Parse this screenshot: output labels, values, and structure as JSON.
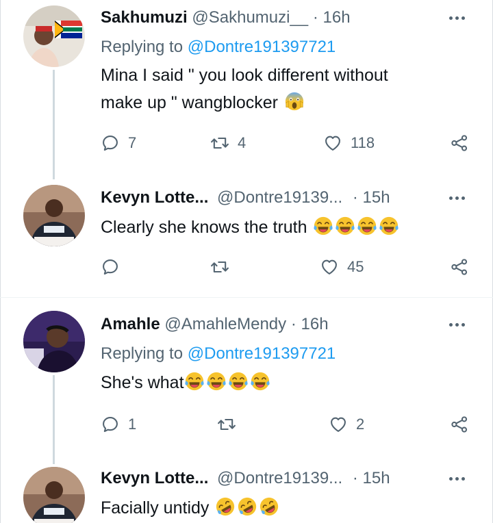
{
  "tweets": [
    {
      "name": "Sakhumuzi",
      "handle": "@Sakhumuzi__",
      "time": "16h",
      "replying_label": "Replying to",
      "replying_to": "@Dontre191397721",
      "text_line1": "Mina I said \" you look different without",
      "text_line2": "make up \" wangblocker",
      "emoji": [
        "face-screaming-in-fear"
      ],
      "counts": {
        "replies": "7",
        "retweets": "4",
        "likes": "118"
      }
    },
    {
      "name": "Kevyn Lotte...",
      "handle": "@Dontre19139...",
      "time": "15h",
      "text": "Clearly she knows the truth",
      "emoji": [
        "tears-of-joy",
        "tears-of-joy",
        "tears-of-joy",
        "tears-of-joy"
      ],
      "counts": {
        "replies": "",
        "retweets": "",
        "likes": "45"
      }
    },
    {
      "name": "Amahle",
      "handle": "@AmahleMendy",
      "time": "16h",
      "replying_label": "Replying to",
      "replying_to": "@Dontre191397721",
      "text": "She's what",
      "emoji": [
        "tears-of-joy",
        "tears-of-joy",
        "tears-of-joy",
        "tears-of-joy"
      ],
      "counts": {
        "replies": "1",
        "retweets": "",
        "likes": "2"
      }
    },
    {
      "name": "Kevyn Lotte...",
      "handle": "@Dontre19139...",
      "time": "15h",
      "text": "Facially untidy",
      "emoji": [
        "rolling-on-floor-laughing",
        "rolling-on-floor-laughing",
        "rolling-on-floor-laughing"
      ]
    }
  ],
  "separator": "·",
  "icons": {
    "reply": "reply-icon",
    "retweet": "retweet-icon",
    "like": "heart-icon",
    "share": "share-icon",
    "more": "more-icon"
  },
  "colors": {
    "link": "#1d9bf0",
    "muted": "#536471",
    "text": "#0f1419",
    "thread_line": "#cfd9de"
  }
}
